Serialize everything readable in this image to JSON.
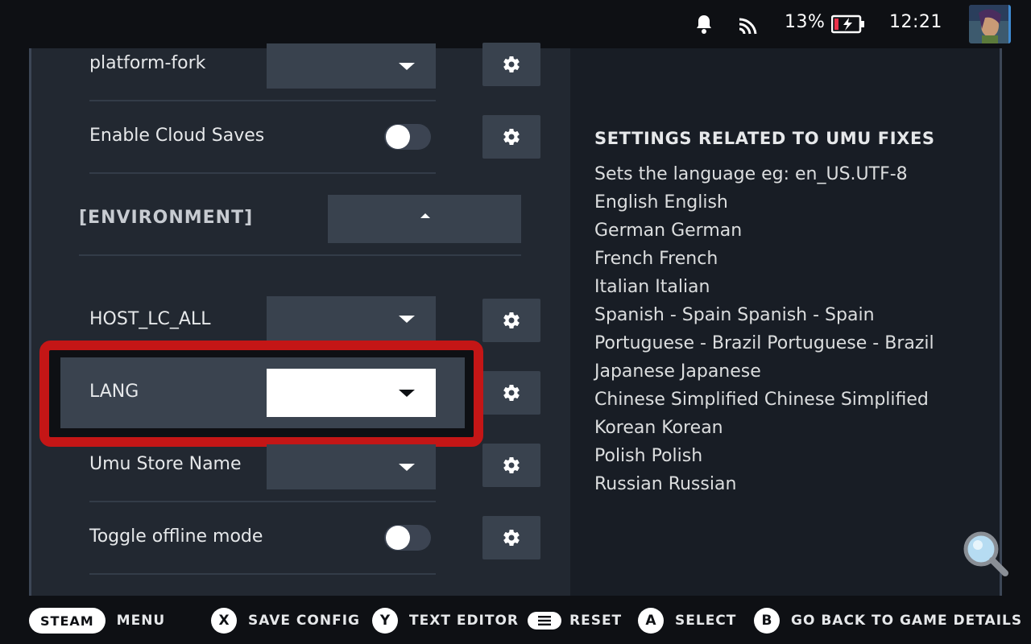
{
  "status_bar": {
    "battery_percent": "13%",
    "time": "12:21",
    "icons": [
      "bell-icon",
      "wifi-icon",
      "battery-charging-icon",
      "avatar"
    ]
  },
  "settings": {
    "rows": [
      {
        "label": "platform-fork",
        "control": "dropdown"
      },
      {
        "label": "Enable Cloud Saves",
        "control": "toggle",
        "on": false
      },
      {
        "label": "HOST_LC_ALL",
        "control": "dropdown"
      },
      {
        "label": "LANG",
        "control": "dropdown",
        "focused": true
      },
      {
        "label": "Umu Store Name",
        "control": "dropdown"
      },
      {
        "label": "Toggle offline mode",
        "control": "toggle",
        "on": false
      }
    ],
    "section_header": "[ENVIRONMENT]"
  },
  "description": {
    "title": "SETTINGS RELATED TO UMU FIXES",
    "lines": [
      "Sets the language eg: en_US.UTF-8",
      "English English",
      "German German",
      "French French",
      "Italian Italian",
      "Spanish - Spain Spanish - Spain",
      "Portuguese - Brazil Portuguese - Brazil",
      "Japanese Japanese",
      "Chinese Simplified Chinese Simplified",
      "Korean Korean",
      "Polish Polish",
      "Russian Russian"
    ]
  },
  "legend": [
    {
      "button": "STEAM",
      "label": "MENU"
    },
    {
      "button": "X",
      "label": "SAVE CONFIG"
    },
    {
      "button": "Y",
      "label": "TEXT EDITOR"
    },
    {
      "button": "menu",
      "label": "RESET"
    },
    {
      "button": "A",
      "label": "SELECT"
    },
    {
      "button": "B",
      "label": "GO BACK TO GAME DETAILS"
    }
  ],
  "colors": {
    "focus_ring": "#c41616",
    "panel": "#222831",
    "control": "#39424e",
    "accent": "#3e8ad1"
  }
}
